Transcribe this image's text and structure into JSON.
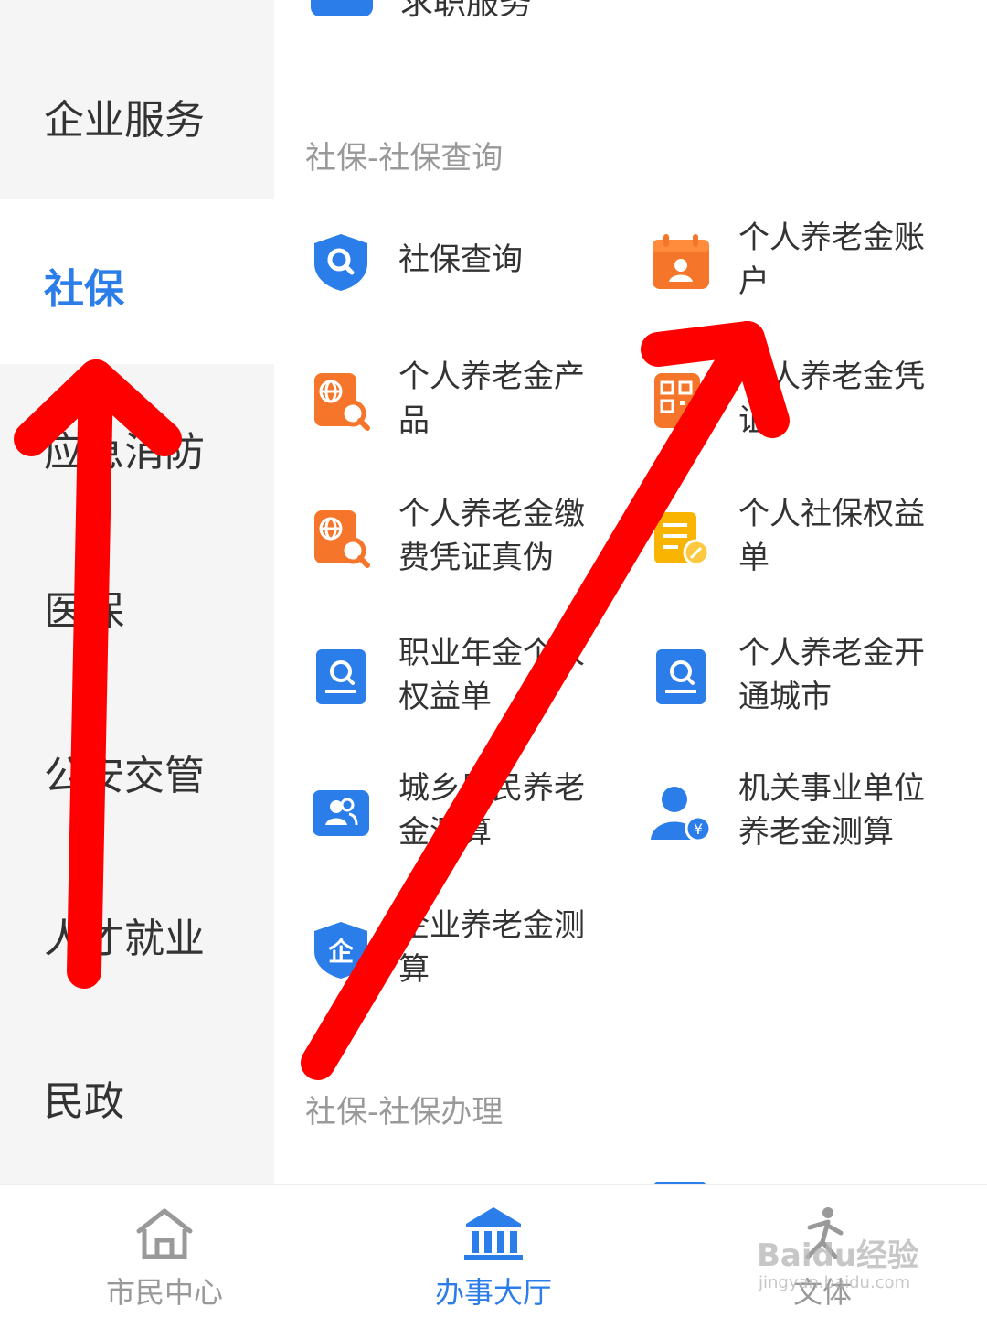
{
  "sidebar": {
    "items": [
      {
        "label": "企业服务"
      },
      {
        "label": "社保"
      },
      {
        "label": "应急消防"
      },
      {
        "label": "医保"
      },
      {
        "label": "公安交管"
      },
      {
        "label": "人才就业"
      },
      {
        "label": "民政"
      }
    ],
    "active_index": 1
  },
  "main": {
    "top_partial_label": "求职服务",
    "sections": [
      {
        "title": "社保-社保查询",
        "services": [
          {
            "label": "社保查询",
            "icon": "shield-search-icon"
          },
          {
            "label": "个人养老金账户",
            "icon": "calendar-person-icon"
          },
          {
            "label": "个人养老金产品",
            "icon": "globe-search-icon"
          },
          {
            "label": "个人养老金凭证",
            "icon": "qr-code-icon"
          },
          {
            "label": "个人养老金缴费凭证真伪",
            "icon": "globe-search-icon"
          },
          {
            "label": "个人社保权益单",
            "icon": "document-edit-icon"
          },
          {
            "label": "职业年金个人权益单",
            "icon": "receipt-search-icon"
          },
          {
            "label": "个人养老金开通城市",
            "icon": "receipt-search-icon"
          },
          {
            "label": "城乡居民养老金测算",
            "icon": "users-card-icon"
          },
          {
            "label": "机关事业单位养老金测算",
            "icon": "person-yuan-icon"
          },
          {
            "label": "企业养老金测算",
            "icon": "shield-enterprise-icon"
          }
        ]
      },
      {
        "title": "社保-社保办理"
      }
    ]
  },
  "bottom_nav": {
    "items": [
      {
        "label": "市民中心",
        "icon": "home-icon"
      },
      {
        "label": "办事大厅",
        "icon": "bank-icon"
      },
      {
        "label": "文体",
        "icon": "runner-icon"
      }
    ],
    "active_index": 1
  },
  "watermark": {
    "text": "Baidu经验",
    "sub": "jingyan.baidu.com"
  },
  "colors": {
    "accent": "#2b7de9",
    "annotation_arrow": "#ff0000",
    "orange": "#f5762a"
  }
}
